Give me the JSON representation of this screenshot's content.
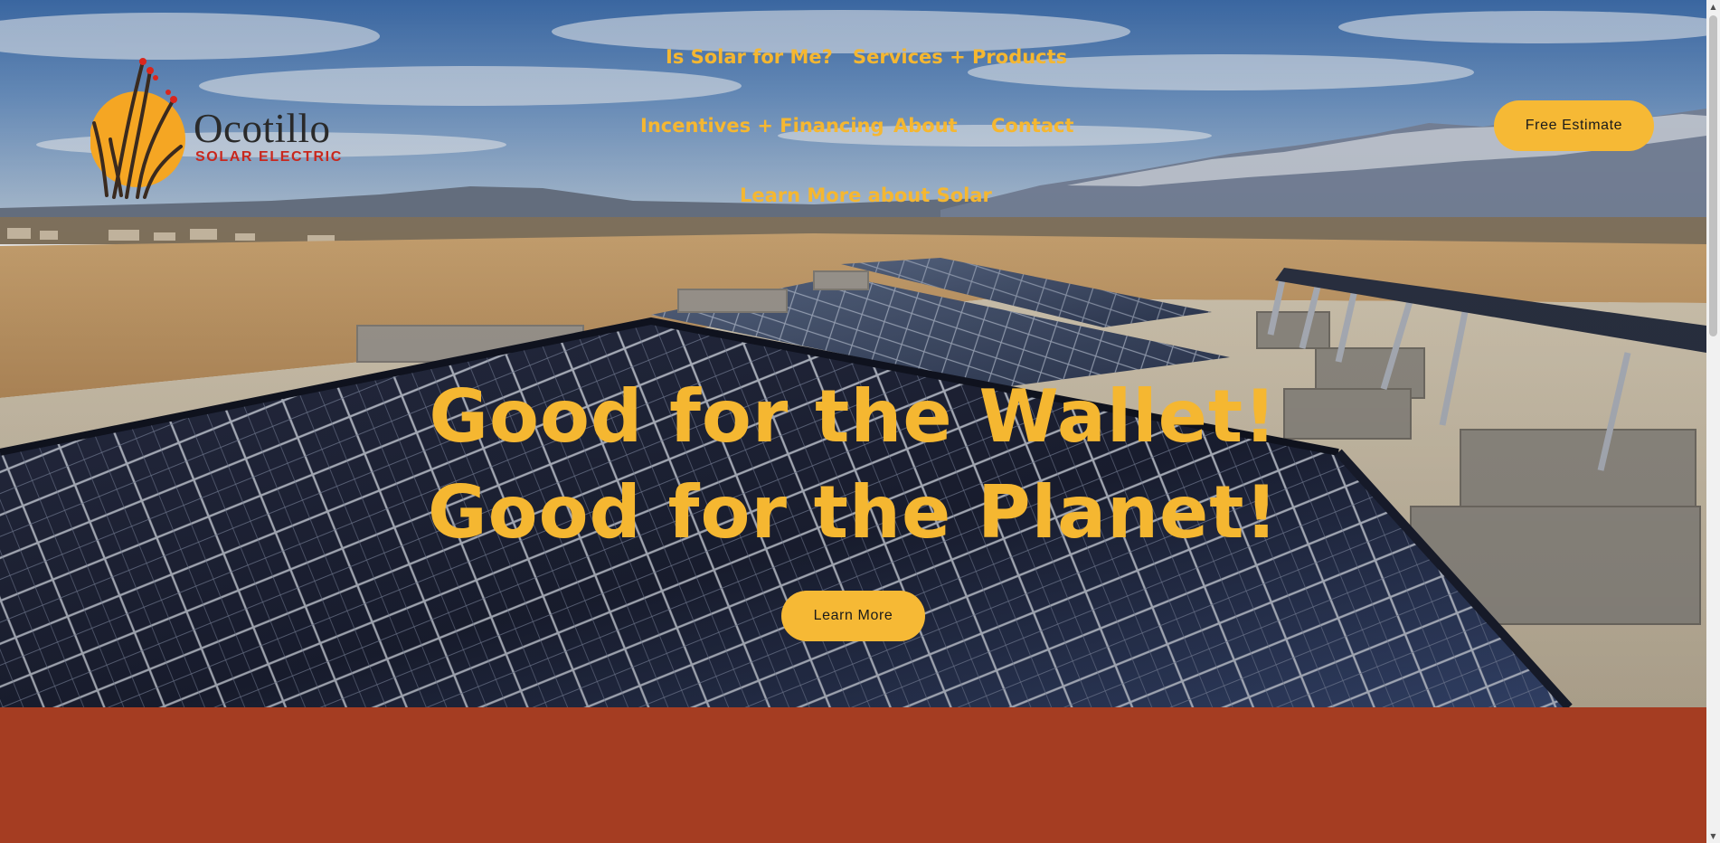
{
  "brand": {
    "name": "Ocotillo",
    "tagline": "SOLAR ELECTRIC",
    "sun_color": "#f5a623",
    "tagline_color": "#c8281e"
  },
  "nav": {
    "items": [
      {
        "label": "Is Solar for Me?"
      },
      {
        "label": "Services + Products"
      },
      {
        "label": "Incentives + Financing"
      },
      {
        "label": "About"
      },
      {
        "label": "Contact"
      },
      {
        "label": "Learn More about Solar"
      }
    ],
    "link_color": "#f5b731"
  },
  "cta": {
    "estimate_label": "Free Estimate",
    "learn_label": "Learn More",
    "button_color": "#f6b935"
  },
  "hero": {
    "headline_line1": "Good for the Wallet!",
    "headline_line2": "Good for the Planet!",
    "image": "rooftop-solar-panels-mountain-view"
  },
  "band": {
    "color": "#a53d22"
  }
}
